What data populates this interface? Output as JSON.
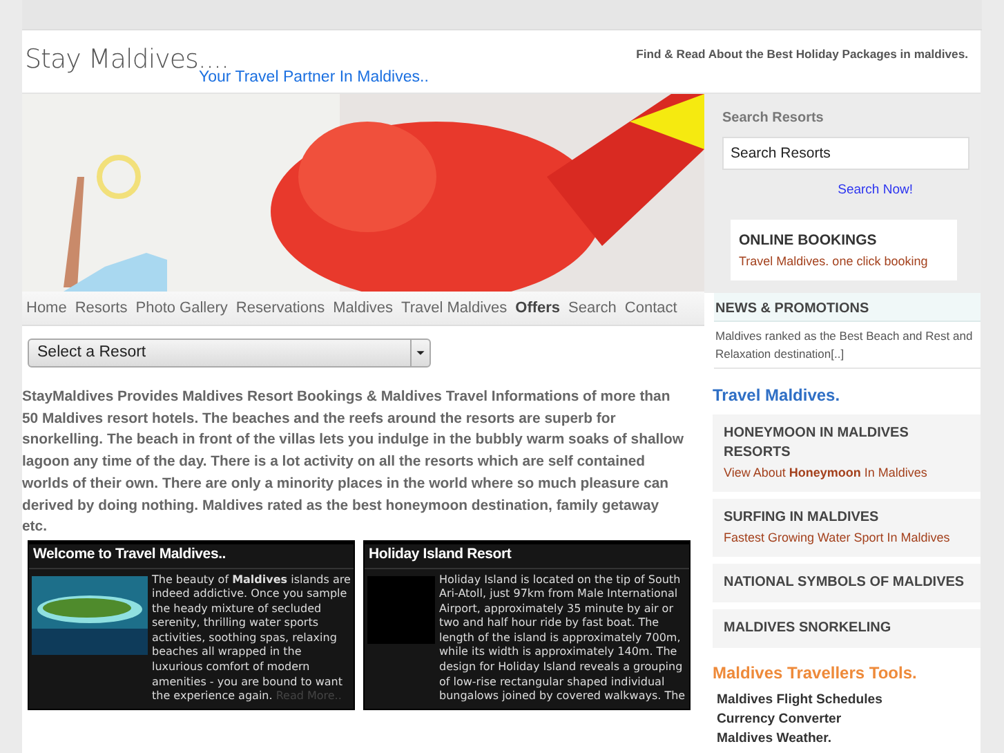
{
  "header": {
    "title": "Stay Maldives....",
    "tagline": "Your Travel Partner In Maldives..",
    "slogan": "Find & Read About the Best Holiday Packages in maldives."
  },
  "nav": [
    {
      "label": "Home",
      "selected": false
    },
    {
      "label": "Resorts",
      "selected": false
    },
    {
      "label": "Photo Gallery",
      "selected": false
    },
    {
      "label": "Reservations",
      "selected": false
    },
    {
      "label": "Maldives",
      "selected": false
    },
    {
      "label": "Travel Maldives",
      "selected": false
    },
    {
      "label": "Offers",
      "selected": true
    },
    {
      "label": "Search",
      "selected": false
    },
    {
      "label": "Contact",
      "selected": false
    }
  ],
  "resort_select": {
    "value": "Select a Resort"
  },
  "intro": "StayMaldives Provides Maldives Resort Bookings & Maldives Travel Informations of more than 50 Maldives resort hotels. The beaches and the reefs around the resorts are superb for snorkelling. The beach in front of the villas lets you indulge in the bubbly warm soaks of shallow lagoon any time of the day. There is a lot activity on all the resorts which are self contained worlds of their own. There are only a minority places in the world where so much pleasure can derived by doing nothing. Maldives rated as the best honeymoon destination, family getaway etc.",
  "cards": [
    {
      "title": "Welcome to Travel Maldives..",
      "kind": "island",
      "text": "The beauty of **Maldives** islands are indeed addictive. Once you sample the heady mixture of secluded serenity, thrilling water sports activities, soothing spas, relaxing beaches all wrapped in the luxurious comfort of modern amenities - you are bound to want the experience again.",
      "link": "Read More.."
    },
    {
      "title": "Holiday Island Resort",
      "kind": "dark",
      "text": "Holiday Island is located on the tip of South Ari-Atoll, just 97km from Male International Airport, approximately 35 minute by air or two and half hour ride by fast boat. The length of the island is approximately 700m, while its width is approximately 140m. The design for Holiday Island reveals a grouping of low-rise rectangular shaped individual bungalows joined by covered walkways. The"
    }
  ],
  "sidebar": {
    "search": {
      "heading": "Search Resorts",
      "value": "Search Resorts",
      "button": "Search Now!"
    },
    "online_bookings": {
      "title": "ONLINE BOOKINGS",
      "text": "Travel Maldives. one click booking"
    },
    "news": {
      "heading": "NEWS & PROMOTIONS",
      "items": [
        "Maldives ranked as the Best Beach and Rest and Relaxation destination[..]"
      ]
    },
    "travel": {
      "heading": "Travel Maldives.",
      "items": [
        {
          "title": "HONEYMOON IN MALDIVES RESORTS",
          "text": "View About **Honeymoon** In Maldives"
        },
        {
          "title": "SURFING IN MALDIVES",
          "text": "Fastest Growing Water Sport In Maldives"
        },
        {
          "title": "NATIONAL SYMBOLS OF MALDIVES"
        },
        {
          "title": "MALDIVES SNORKELING"
        }
      ]
    },
    "tools": {
      "heading": "Maldives Travellers Tools.",
      "links": [
        "Maldives Flight Schedules",
        "Currency Converter",
        "Maldives Weather."
      ]
    }
  }
}
